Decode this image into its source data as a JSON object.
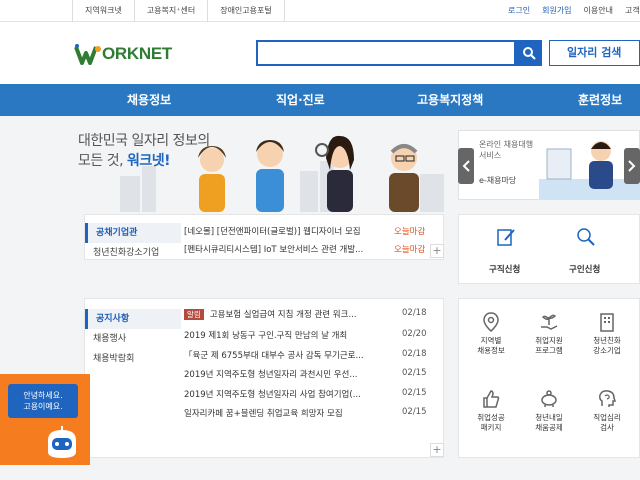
{
  "topbar": {
    "left_links": [
      "지역워크넷",
      "고용복지⁺센터",
      "장애인고용포털"
    ],
    "right_links": [
      {
        "label": "로그인",
        "color": "#1f5fb5"
      },
      {
        "label": "회원가입",
        "color": "#1f5fb5"
      },
      {
        "label": "이용안내",
        "color": "#444444"
      },
      {
        "label": "고객",
        "color": "#444444"
      }
    ]
  },
  "header": {
    "logo_text": "ORKNET",
    "search_placeholder": "",
    "search_icon": "search-icon",
    "job_search_label": "일자리 검색"
  },
  "gnb": {
    "items": [
      "채용정보",
      "직업·진로",
      "고용복지정책",
      "훈련정보"
    ]
  },
  "hero": {
    "line1": "대한민국 일자리 정보의",
    "line2_prefix": "모든 것, ",
    "line2_highlight": "워크넷!"
  },
  "side_banner": {
    "line1": "온라인 채용대행",
    "line2": "서비스",
    "line3": "e-채용마당"
  },
  "public_panel": {
    "tabs": [
      "공채기업관",
      "청년친화강소기업"
    ],
    "items": [
      {
        "text": "[네오몰] [던전앤파이터(글로벌)] 웹디자이너 모집",
        "deadline": "오늘마감"
      },
      {
        "text": "[펜타시큐리티시스템] IoT 보안서비스 관련 개발...",
        "deadline": "오늘마감"
      }
    ]
  },
  "service_panel": {
    "items": [
      {
        "label": "구직신청",
        "icon": "resume-pen-icon"
      },
      {
        "label": "구인신청",
        "icon": "magnifier-icon"
      }
    ]
  },
  "notice_panel": {
    "tabs": [
      "공지사항",
      "채용행사",
      "채용박람회"
    ],
    "items": [
      {
        "tag": "알림",
        "text": "고용보험 실업급여 지침 개정 관련 워크...",
        "date": "02/18"
      },
      {
        "tag": "",
        "text": "2019 제1회 낭동구 구인.구직 만남의 날 개최",
        "date": "02/20"
      },
      {
        "tag": "",
        "text": "「육군 제 6755부대 대부수 공사 감독 무기근로...",
        "date": "02/18"
      },
      {
        "tag": "",
        "text": "2019년 지역주도형 청년일자리 과천시민 우선...",
        "date": "02/15"
      },
      {
        "tag": "",
        "text": "2019년 지역주도형 청년일자리 사업 참여기업(...",
        "date": "02/15"
      },
      {
        "tag": "",
        "text": "일자리카페 꿈+블렌딩 취업교육 희망자 모집",
        "date": "02/15"
      }
    ]
  },
  "quick_menu": {
    "items": [
      {
        "label1": "지역별",
        "label2": "채용정보",
        "icon": "map-pin-icon"
      },
      {
        "label1": "취업지원",
        "label2": "프로그램",
        "icon": "sprout-hand-icon"
      },
      {
        "label1": "청년친화",
        "label2": "강소기업",
        "icon": "building-icon"
      },
      {
        "label1": "취업성공",
        "label2": "패키지",
        "icon": "thumbs-up-icon"
      },
      {
        "label1": "청년내일",
        "label2": "채움공제",
        "icon": "piggy-bank-icon"
      },
      {
        "label1": "직업심리",
        "label2": "검사",
        "icon": "mind-test-icon"
      }
    ]
  },
  "chatbot": {
    "line1": "안녕하세요.",
    "line2": "고용이예요."
  },
  "colors": {
    "brand_blue": "#1f65c0",
    "nav_blue": "#2a78c2",
    "deadline_orange": "#e0541e",
    "chatbot_orange": "#f57c1f",
    "logo_green": "#2e7d32"
  }
}
